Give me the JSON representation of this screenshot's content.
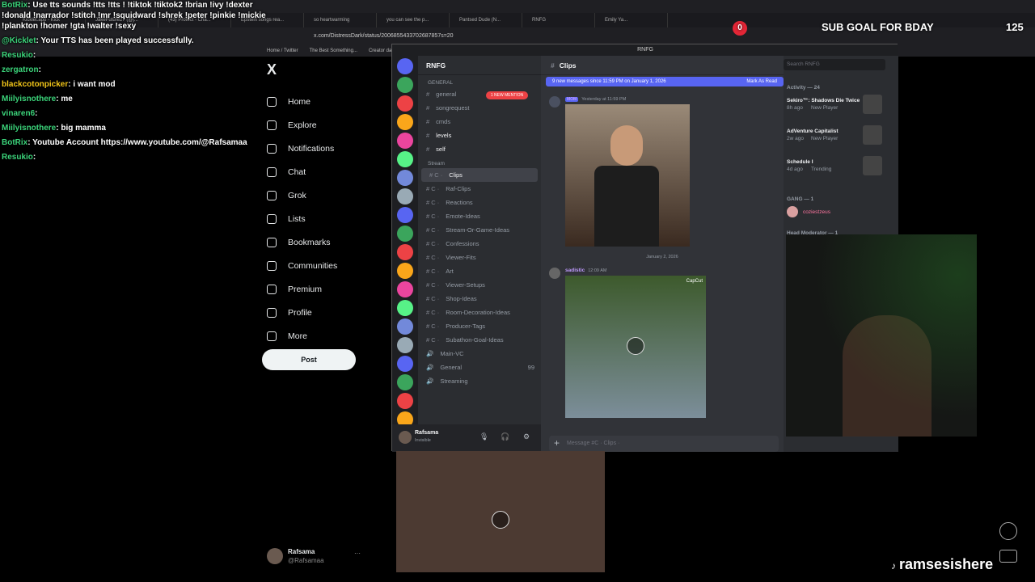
{
  "browser": {
    "tabs": [
      "Kicklet.app - Kick",
      "JakeFuture27 (@j...",
      "(43) Protect - Cha...",
      "Epstein songs rea...",
      "so heartwarming",
      "you can see the p...",
      "Pantsed Dude (N...",
      "RNFG",
      "Emily Ya..."
    ],
    "url": "x.com/DistressDark/status/2006855433702687857s=20",
    "bookmarks": [
      "Home / Twitter",
      "The Best Something...",
      "Creator dashboard |...",
      "https://www.instagr...",
      "Watch Latest Episod...",
      "All Bookmarks"
    ]
  },
  "chat": [
    {
      "name": "BotRix",
      "msg": "Use tts sounds !tts !tts ! !tiktok !tiktok2 !brian !ivy !dexter !donald !narrador !stitch !mr !squidward !shrek !peter !pinkie !mickie !plankton !homer !gta !walter !sexy",
      "color": "green"
    },
    {
      "name": "@Kicklet",
      "msg": "Your TTS has been played successfully.",
      "color": "green"
    },
    {
      "name": "Resukio",
      "msg": "",
      "color": "green"
    },
    {
      "name": "zergatron",
      "msg": "",
      "color": "green"
    },
    {
      "name": "blackcotonpicker",
      "msg": "i want mod",
      "color": "yellow"
    },
    {
      "name": "Miilyisnothere",
      "msg": "me",
      "color": "green"
    },
    {
      "name": "vinaren6",
      "msg": "",
      "color": "green"
    },
    {
      "name": "Miilyisnothere",
      "msg": "big mamma",
      "color": "green"
    },
    {
      "name": "BotRix",
      "msg": "Youtube Account https://www.youtube.com/@Rafsamaa",
      "color": "green"
    },
    {
      "name": "Resukio",
      "msg": "",
      "color": "green"
    }
  ],
  "x": {
    "logo": "X",
    "nav": [
      {
        "label": "Home",
        "icon": "home-icon"
      },
      {
        "label": "Explore",
        "icon": "search-icon"
      },
      {
        "label": "Notifications",
        "icon": "bell-icon"
      },
      {
        "label": "Chat",
        "icon": "mail-icon"
      },
      {
        "label": "Grok",
        "icon": "grok-icon"
      },
      {
        "label": "Lists",
        "icon": "list-icon"
      },
      {
        "label": "Bookmarks",
        "icon": "bookmark-icon"
      },
      {
        "label": "Communities",
        "icon": "people-icon"
      },
      {
        "label": "Premium",
        "icon": "x-icon"
      },
      {
        "label": "Profile",
        "icon": "user-icon"
      },
      {
        "label": "More",
        "icon": "more-icon"
      }
    ],
    "post_label": "Post",
    "user": {
      "name": "Rafsama",
      "handle": "@Rafsamaa",
      "dots": "···"
    }
  },
  "discord": {
    "window_title": "RNFG",
    "server_name": "RNFG",
    "mention_badge": "1 NEW MENTION",
    "categories": {
      "general": "GENERAL",
      "stream": "Stream"
    },
    "general_channels": [
      "general",
      "songrequest",
      "cmds",
      "levels",
      "self"
    ],
    "stream_channels": [
      "Clips",
      "Raf-Clips",
      "Reactions",
      "Emote-Ideas",
      "Stream-Or-Game-Ideas",
      "Confessions",
      "Viewer-Fits",
      "Art",
      "Viewer-Setups",
      "Shop-Ideas",
      "Room-Decoration-Ideas",
      "Producer-Tags",
      "Subathon-Goal-Ideas"
    ],
    "voice_channels": [
      "Main-VC",
      "General",
      "Streaming"
    ],
    "voice_count": "99",
    "new_badge": "NEW",
    "user_panel": {
      "name": "Rafsama",
      "status": "Invisible"
    },
    "header_channel": "Clips",
    "new_messages": "9 new messages since 11:59 PM on January 1, 2026",
    "mark_read": "Mark As Read",
    "messages": [
      {
        "author": "",
        "role": "MOM",
        "time": "Yesterday at 11:59 PM"
      },
      {
        "author": "sadistic",
        "role": "",
        "time": "12:09 AM"
      }
    ],
    "date_divider": "January 2, 2026",
    "capcut_label": "CapCut",
    "input_placeholder": "Message #C · Clips ·",
    "search_placeholder": "Search RNFG",
    "activity_header": "Activity — 24",
    "activities": [
      {
        "title": "Sekiro™: Shadows Die Twice",
        "sub": "8h ago",
        "tag": "New Player"
      },
      {
        "title": "AdVenture Capitalist",
        "sub": "2w ago",
        "tag": "New Player"
      },
      {
        "title": "Schedule I",
        "sub": "4d ago",
        "tag": "Trending"
      }
    ],
    "gang_header": "GANG — 1",
    "gang_member": "coziestzeus",
    "head_mod_header": "Head Moderator — 1"
  },
  "overlay": {
    "sub_goal": "SUB GOAL FOR BDAY",
    "sub_current": "0",
    "sub_target": "125",
    "tiktok": "ramsesishere"
  }
}
